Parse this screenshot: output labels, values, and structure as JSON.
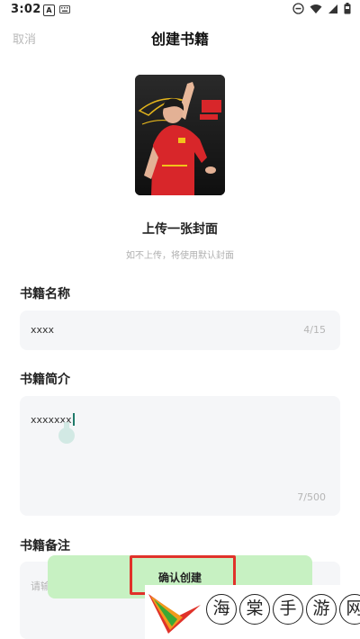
{
  "status_bar": {
    "time": "3:02",
    "notification_icon_letter": "A",
    "icons": [
      "keyboard-icon",
      "dnd-icon",
      "wifi-icon",
      "signal-icon",
      "battery-icon"
    ]
  },
  "nav": {
    "cancel_label": "取消",
    "title": "创建书籍"
  },
  "cover": {
    "upload_title": "上传一张封面",
    "upload_hint": "如不上传，将使用默认封面"
  },
  "fields": {
    "name": {
      "label": "书籍名称",
      "value": "xxxx",
      "count": "4/15"
    },
    "intro": {
      "label": "书籍简介",
      "value": "xxxxxxx",
      "count": "7/500"
    },
    "note": {
      "label": "书籍备注",
      "placeholder": "请输"
    }
  },
  "confirm": {
    "label": "确认创建"
  },
  "watermark": {
    "chars": [
      "海",
      "棠",
      "手",
      "游",
      "网"
    ]
  },
  "colors": {
    "accent_green": "#c7f1c2",
    "cursor_teal": "#1f7a6a",
    "highlight_red": "#e0322a",
    "field_bg": "#f5f6f8"
  }
}
